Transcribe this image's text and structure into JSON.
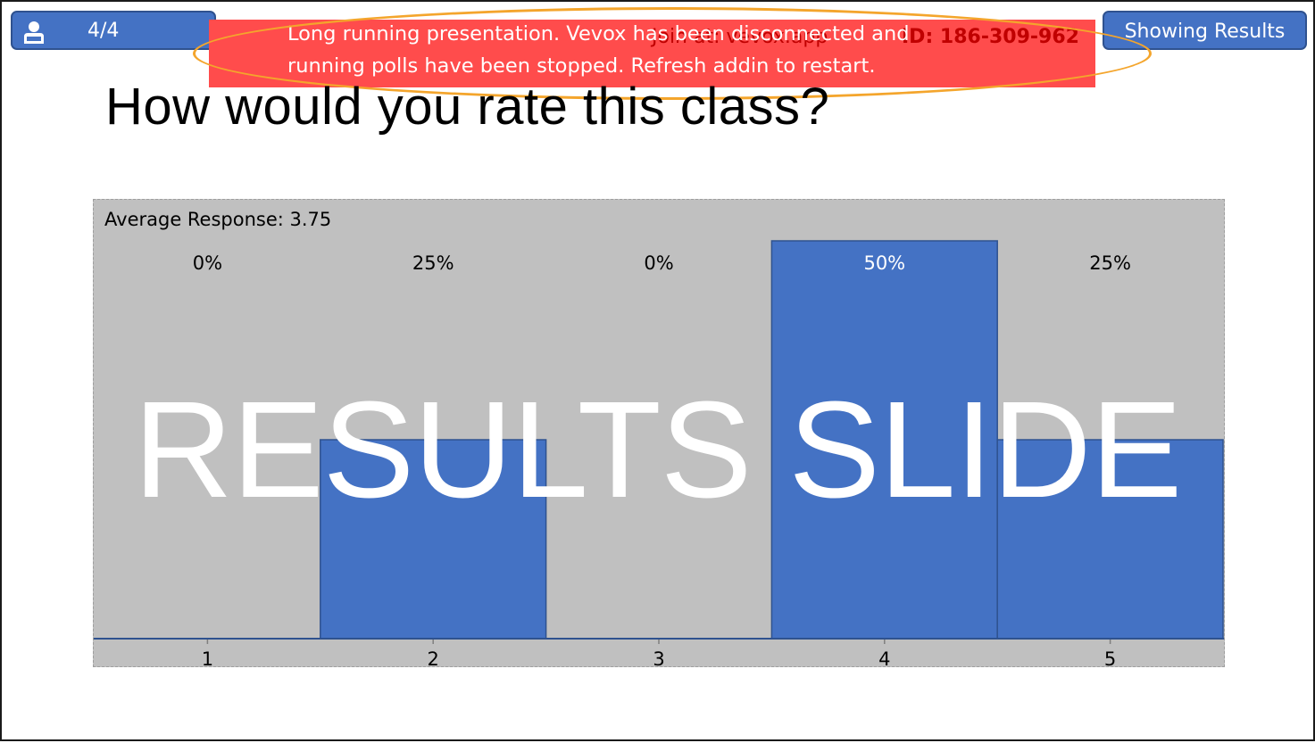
{
  "header": {
    "slide_counter": "4/4",
    "status_label": "Showing Results",
    "join_info": "Join at: vevox.app",
    "session_id": "ID: 186-309-962"
  },
  "alert": {
    "line1": "Long running presentation. Vevox has been disconnected and",
    "line2": "running polls have been stopped. Refresh addin to restart."
  },
  "slide": {
    "question": "How would you rate this class?",
    "average_label": "Average Response: 3.75",
    "watermark": "RESULTS SLIDE"
  },
  "colors": {
    "accent": "#4472c4",
    "alert_bg": "#ff4c4c",
    "outline": "#f4a52c",
    "chart_bg": "#c0c0c0"
  },
  "icons": {
    "counter_icon": "user-icon"
  },
  "chart_data": {
    "type": "bar",
    "categories": [
      "1",
      "2",
      "3",
      "4",
      "5"
    ],
    "values": [
      0,
      25,
      0,
      50,
      25
    ],
    "value_labels": [
      "0%",
      "25%",
      "0%",
      "50%",
      "25%"
    ],
    "ylim": [
      0,
      50
    ],
    "grid": false,
    "bar_color": "#4472c4"
  }
}
